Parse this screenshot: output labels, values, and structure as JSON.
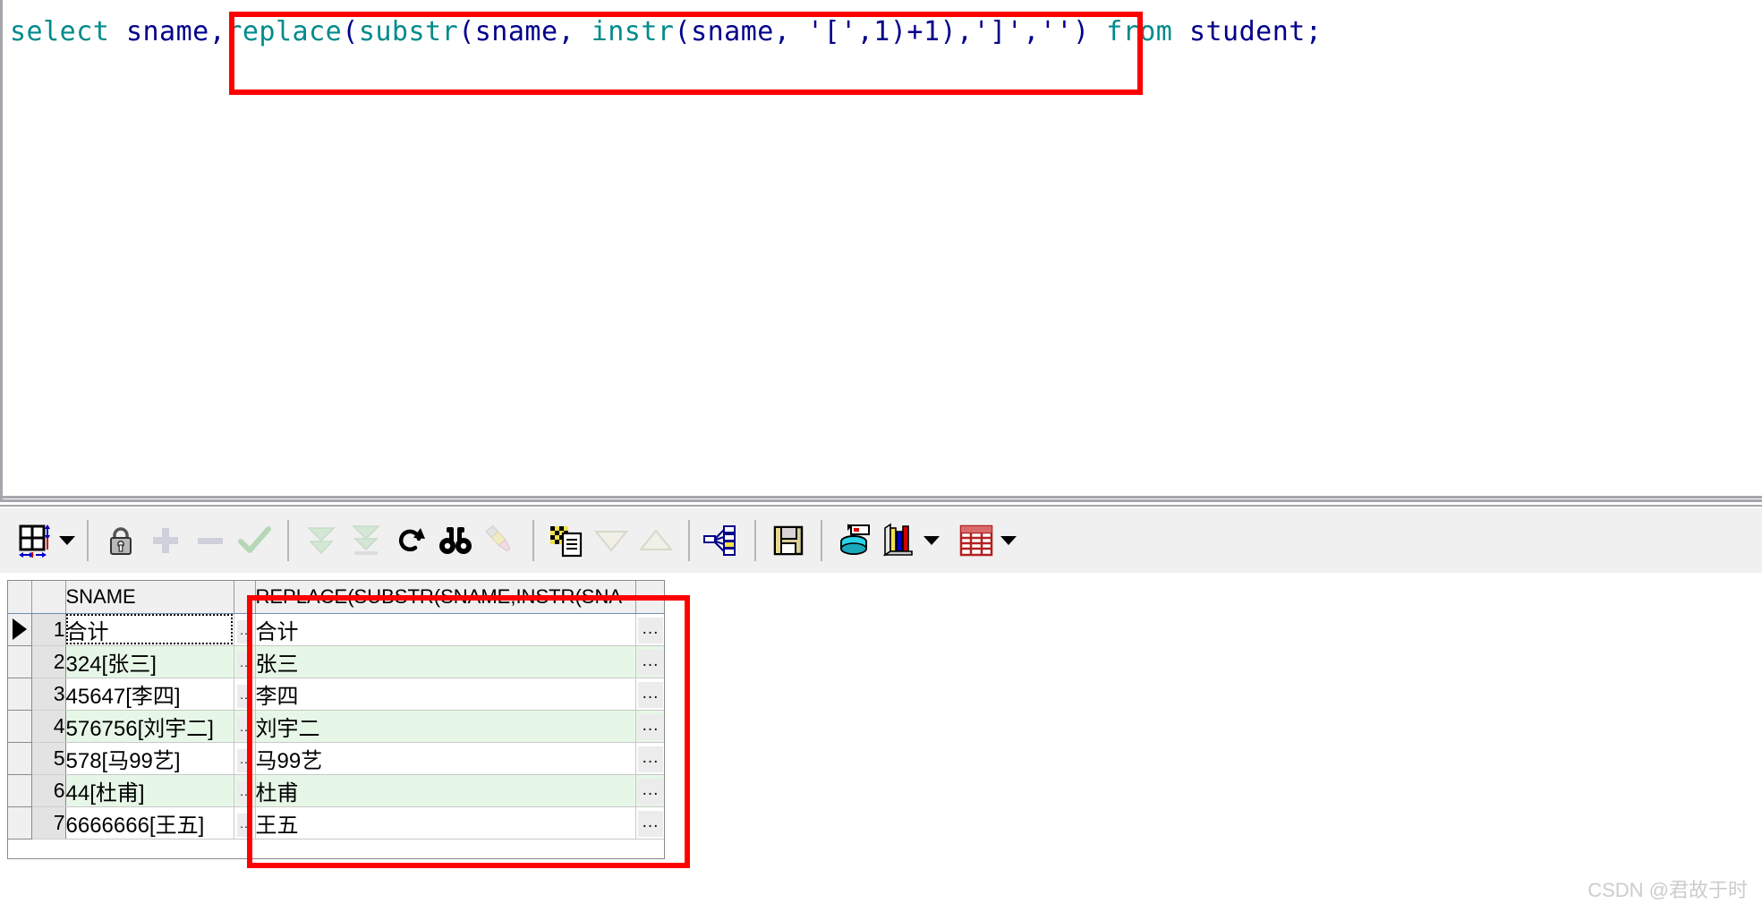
{
  "editor": {
    "sql_full": "select sname,replace(substr(sname, instr(sname, '[',1)+1),']','') from student;",
    "tokens": [
      {
        "t": "select",
        "c": "kw"
      },
      {
        "t": " ",
        "c": "sp"
      },
      {
        "t": "sname",
        "c": "id"
      },
      {
        "t": ",",
        "c": "punct"
      },
      {
        "t": "replace",
        "c": "fn"
      },
      {
        "t": "(",
        "c": "punct"
      },
      {
        "t": "substr",
        "c": "fn"
      },
      {
        "t": "(",
        "c": "punct"
      },
      {
        "t": "sname",
        "c": "id"
      },
      {
        "t": ", ",
        "c": "punct"
      },
      {
        "t": "instr",
        "c": "fn"
      },
      {
        "t": "(",
        "c": "punct"
      },
      {
        "t": "sname",
        "c": "id"
      },
      {
        "t": ", ",
        "c": "punct"
      },
      {
        "t": "'['",
        "c": "str"
      },
      {
        "t": ",",
        "c": "punct"
      },
      {
        "t": "1",
        "c": "num"
      },
      {
        "t": ")+",
        "c": "punct"
      },
      {
        "t": "1",
        "c": "num"
      },
      {
        "t": "),",
        "c": "punct"
      },
      {
        "t": "']'",
        "c": "str"
      },
      {
        "t": ",",
        "c": "punct"
      },
      {
        "t": "''",
        "c": "str"
      },
      {
        "t": ")",
        "c": "punct"
      },
      {
        "t": " ",
        "c": "sp"
      },
      {
        "t": "from",
        "c": "kw"
      },
      {
        "t": " ",
        "c": "sp"
      },
      {
        "t": "student",
        "c": "id"
      },
      {
        "t": ";",
        "c": "punct"
      }
    ]
  },
  "annotations": {
    "color": "#fe0000",
    "sql_highlight_text": "replace(substr(sname, instr(sname, '[',1)+1),']','')",
    "grid_highlight_column": "REPLACE(SUBSTR(SNAME,INSTR(SNA"
  },
  "toolbar": {
    "buttons": [
      {
        "name": "grid-layout-icon",
        "label": "Grid layout",
        "enabled": true,
        "has_caret": true
      },
      {
        "name": "lock-icon",
        "label": "Lock record",
        "enabled": true,
        "has_caret": false
      },
      {
        "name": "plus-icon",
        "label": "Insert record",
        "enabled": false,
        "has_caret": false
      },
      {
        "name": "minus-icon",
        "label": "Delete record",
        "enabled": false,
        "has_caret": false
      },
      {
        "name": "check-icon",
        "label": "Post changes",
        "enabled": false,
        "has_caret": false
      },
      {
        "name": "fetch-next-page-icon",
        "label": "Fetch next page",
        "enabled": false,
        "has_caret": false
      },
      {
        "name": "fetch-last-page-icon",
        "label": "Fetch last page",
        "enabled": false,
        "has_caret": false
      },
      {
        "name": "refresh-icon",
        "label": "Refresh",
        "enabled": true,
        "has_caret": false
      },
      {
        "name": "binoculars-icon",
        "label": "Find",
        "enabled": true,
        "has_caret": false
      },
      {
        "name": "highlighter-icon",
        "label": "Highlight",
        "enabled": false,
        "has_caret": false
      },
      {
        "name": "copy-to-clipboard-icon",
        "label": "Copy to clipboard",
        "enabled": true,
        "has_caret": false
      },
      {
        "name": "sort-descending-icon",
        "label": "Sort descending",
        "enabled": false,
        "has_caret": false
      },
      {
        "name": "sort-ascending-icon",
        "label": "Sort ascending",
        "enabled": false,
        "has_caret": false
      },
      {
        "name": "query-plan-icon",
        "label": "Explain plan",
        "enabled": true,
        "has_caret": false
      },
      {
        "name": "save-icon",
        "label": "Save",
        "enabled": true,
        "has_caret": false
      },
      {
        "name": "database-export-icon",
        "label": "Export data",
        "enabled": true,
        "has_caret": false
      },
      {
        "name": "chart-icon",
        "label": "Chart",
        "enabled": true,
        "has_caret": true
      },
      {
        "name": "table-grid-icon",
        "label": "Data grid",
        "enabled": true,
        "has_caret": true
      }
    ]
  },
  "grid": {
    "columns": [
      {
        "key": "marker",
        "label": ""
      },
      {
        "key": "rownum",
        "label": ""
      },
      {
        "key": "sname",
        "label": "SNAME"
      },
      {
        "key": "dots1",
        "label": ""
      },
      {
        "key": "result",
        "label": "REPLACE(SUBSTR(SNAME,INSTR(SNA"
      },
      {
        "key": "dots2",
        "label": ""
      }
    ],
    "dots_glyph": "...",
    "dots_glyph_small": "..",
    "rows": [
      {
        "n": "1",
        "sname": "合计",
        "result": "合计",
        "alt": false,
        "current": true
      },
      {
        "n": "2",
        "sname": "324[张三]",
        "result": "张三",
        "alt": true,
        "current": false
      },
      {
        "n": "3",
        "sname": "45647[李四]",
        "result": "李四",
        "alt": false,
        "current": false
      },
      {
        "n": "4",
        "sname": "576756[刘宇二]",
        "result": "刘宇二",
        "alt": true,
        "current": false
      },
      {
        "n": "5",
        "sname": "578[马99艺]",
        "result": "马99艺",
        "alt": false,
        "current": false
      },
      {
        "n": "6",
        "sname": "44[杜甫]",
        "result": "杜甫",
        "alt": true,
        "current": false
      },
      {
        "n": "7",
        "sname": "6666666[王五]",
        "result": "王五",
        "alt": false,
        "current": false
      }
    ]
  },
  "watermark": {
    "text": "CSDN @君故于时"
  }
}
